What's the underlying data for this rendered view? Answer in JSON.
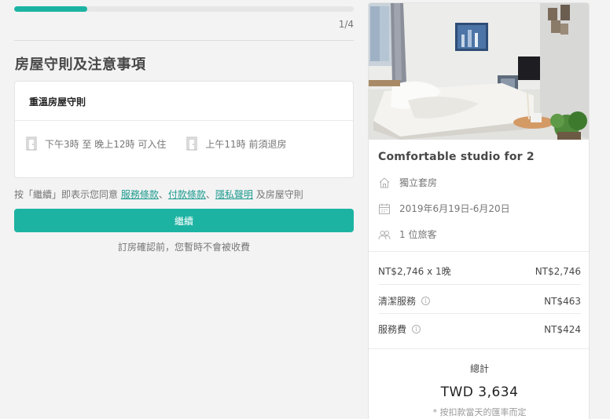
{
  "progress": {
    "step": "1/4",
    "fraction": 0.215
  },
  "page_title": "房屋守則及注意事項",
  "rules_card": {
    "header": "重溫房屋守則",
    "checkin": "下午3時 至 晚上12時 可入住",
    "checkout": "上午11時 前須退房"
  },
  "agreement": {
    "prefix": "按「繼續」即表示您同意 ",
    "terms_of_service": "服務條款",
    "sep1": "、",
    "payment_terms": "付款條款",
    "sep2": "、",
    "privacy_policy": "隱私聲明",
    "suffix": " 及房屋守則"
  },
  "continue_button": "繼續",
  "no_charge_note": "訂房確認前，您暫時不會被收費",
  "listing": {
    "title": "Comfortable studio for 2",
    "room_type": "獨立套房",
    "dates": "2019年6月19日-6月20日",
    "guests": "1 位旅客"
  },
  "pricing": {
    "nightly_label": "NT$2,746 x 1晚",
    "nightly_amount": "NT$2,746",
    "cleaning_label": "清潔服務",
    "cleaning_amount": "NT$463",
    "service_label": "服務費",
    "service_amount": "NT$424",
    "total_label": "總計",
    "total_amount": "TWD 3,634",
    "total_note": "* 按扣款當天的匯率而定"
  },
  "icons": {
    "checkin": "door-icon",
    "checkout": "door-icon",
    "room_type": "house-icon",
    "dates": "calendar-icon",
    "guests": "people-icon",
    "info": "info-icon"
  },
  "colors": {
    "accent": "#1db3a3",
    "link": "#1b9a8f"
  }
}
